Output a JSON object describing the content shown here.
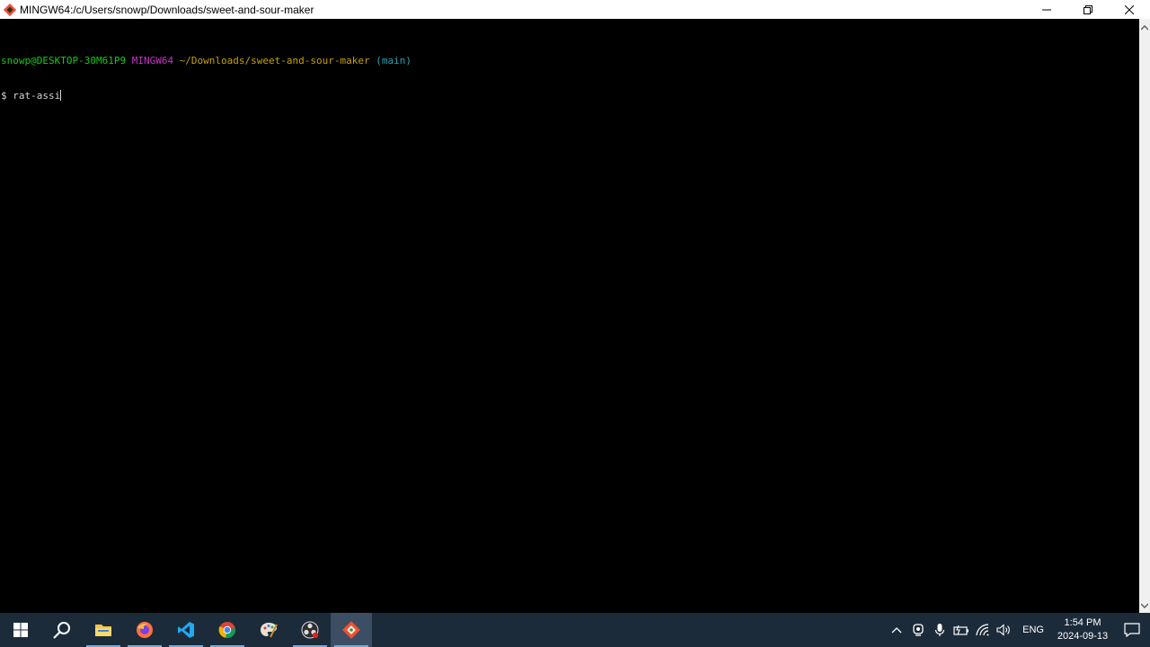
{
  "window": {
    "title": "MINGW64:/c/Users/snowp/Downloads/sweet-and-sour-maker",
    "controls": {
      "minimize": "minimize",
      "maximize": "restore",
      "close": "close"
    }
  },
  "terminal": {
    "prompt": {
      "user_host": "snowp@DESKTOP-30M61P9",
      "system": "MINGW64",
      "path": "~/Downloads/sweet-and-sour-maker",
      "branch": "(main)"
    },
    "command_line": {
      "symbol": "$",
      "input": "rat-assi"
    }
  },
  "taskbar": {
    "apps": [
      {
        "name": "start",
        "icon": "windows-logo-icon"
      },
      {
        "name": "search",
        "icon": "search-icon"
      },
      {
        "name": "file-explorer",
        "icon": "folder-icon"
      },
      {
        "name": "firefox",
        "icon": "firefox-icon"
      },
      {
        "name": "vscode",
        "icon": "vscode-icon"
      },
      {
        "name": "chrome",
        "icon": "chrome-icon"
      },
      {
        "name": "paint",
        "icon": "paint-icon"
      },
      {
        "name": "obs",
        "icon": "obs-icon"
      },
      {
        "name": "git-bash",
        "icon": "git-icon"
      }
    ],
    "tray": {
      "language": "ENG",
      "time": "1:54 PM",
      "date": "2024-09-13"
    }
  },
  "colors": {
    "user_host": "#19c819",
    "system": "#c832c8",
    "path": "#c8a000",
    "branch": "#2aa1b3",
    "taskbar": "#1c2b3a"
  }
}
